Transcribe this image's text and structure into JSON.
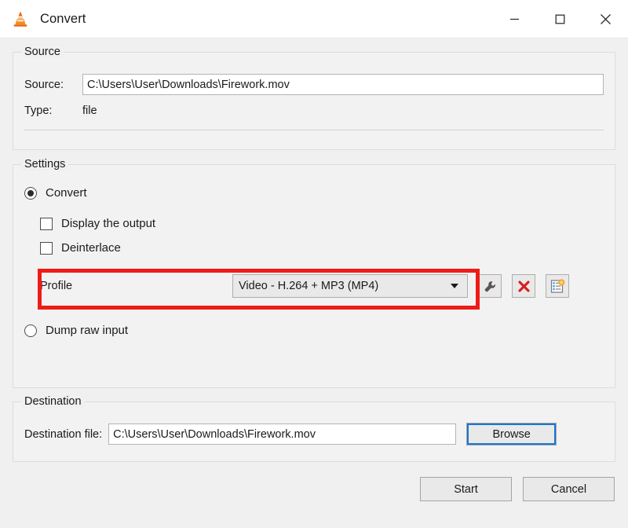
{
  "window": {
    "title": "Convert",
    "app_icon": "vlc-cone-icon",
    "controls": {
      "minimize": "minimize-icon",
      "maximize": "maximize-icon",
      "close": "close-icon"
    }
  },
  "source": {
    "group_title": "Source",
    "source_label": "Source:",
    "source_value": "C:\\Users\\User\\Downloads\\Firework.mov",
    "type_label": "Type:",
    "type_value": "file"
  },
  "settings": {
    "group_title": "Settings",
    "convert_radio": {
      "label": "Convert",
      "selected": true
    },
    "display_output_checkbox": {
      "label": "Display the output",
      "checked": false
    },
    "deinterlace_checkbox": {
      "label": "Deinterlace",
      "checked": false
    },
    "profile": {
      "label": "Profile",
      "selected": "Video - H.264 + MP3 (MP4)",
      "highlighted": true,
      "highlight_color": "#ee1b17",
      "buttons": {
        "edit": "wrench-icon",
        "delete": "red-x-icon",
        "new": "new-profile-icon"
      }
    },
    "dump_radio": {
      "label": "Dump raw input",
      "selected": false
    }
  },
  "destination": {
    "group_title": "Destination",
    "file_label": "Destination file:",
    "file_value": "C:\\Users\\User\\Downloads\\Firework.mov",
    "browse_label": "Browse"
  },
  "footer": {
    "start_label": "Start",
    "cancel_label": "Cancel"
  }
}
